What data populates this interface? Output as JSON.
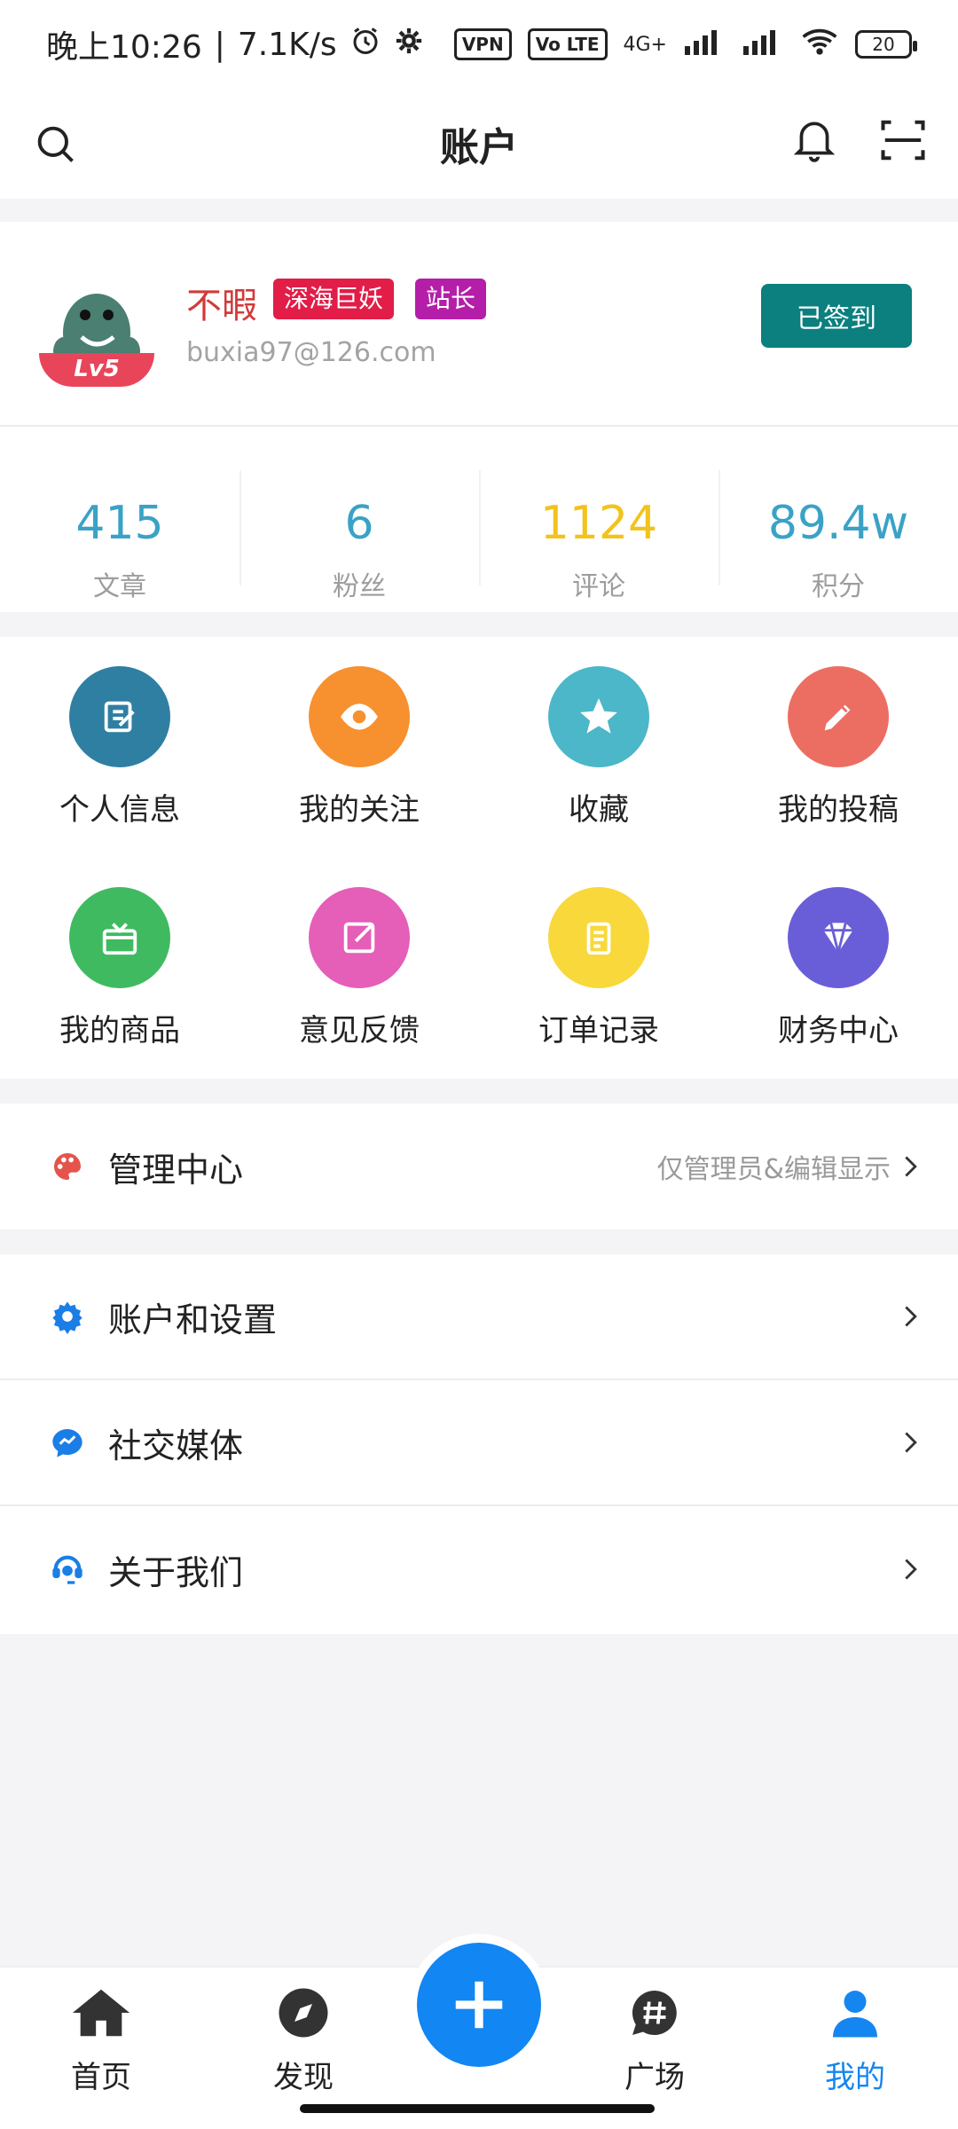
{
  "status_bar": {
    "time": "晚上10:26",
    "speed": "7.1K/s",
    "vpn": "VPN",
    "volte": "Vo LTE",
    "network": "4G+",
    "battery": "20"
  },
  "appbar": {
    "title": "账户"
  },
  "profile": {
    "name": "不暇",
    "tag_rank": "深海巨妖",
    "tag_role": "站长",
    "email": "buxia97@126.com",
    "level": "Lv5",
    "checkin_label": "已签到",
    "stats": [
      {
        "value": "415",
        "label": "文章",
        "color": "#3aa2c6"
      },
      {
        "value": "6",
        "label": "粉丝",
        "color": "#3aa2c6"
      },
      {
        "value": "1124",
        "label": "评论",
        "color": "#f2c31c"
      },
      {
        "value": "89.4w",
        "label": "积分",
        "color": "#3aa2c6"
      }
    ]
  },
  "grid": {
    "items": [
      {
        "label": "个人信息",
        "icon": "edit-icon",
        "color": "#2f7fa3"
      },
      {
        "label": "我的关注",
        "icon": "eye-icon",
        "color": "#f7902f"
      },
      {
        "label": "收藏",
        "icon": "star-icon",
        "color": "#4bb7c8"
      },
      {
        "label": "我的投稿",
        "icon": "pen-icon",
        "color": "#ec6e62"
      },
      {
        "label": "我的商品",
        "icon": "gift-icon",
        "color": "#3fba61"
      },
      {
        "label": "意见反馈",
        "icon": "feedback-icon",
        "color": "#e55eb7"
      },
      {
        "label": "订单记录",
        "icon": "clipboard-icon",
        "color": "#f8d83a"
      },
      {
        "label": "财务中心",
        "icon": "diamond-icon",
        "color": "#6a5ed8"
      }
    ]
  },
  "admin_section": {
    "label": "管理中心",
    "hint": "仅管理员&编辑显示"
  },
  "settings_section": {
    "rows": [
      {
        "label": "账户和设置",
        "icon": "gear-icon"
      },
      {
        "label": "社交媒体",
        "icon": "chat-icon"
      },
      {
        "label": "关于我们",
        "icon": "support-icon"
      }
    ]
  },
  "bottom_nav": {
    "items": [
      {
        "label": "首页",
        "icon": "home-icon"
      },
      {
        "label": "发现",
        "icon": "compass-icon"
      },
      {
        "label": "广场",
        "icon": "hash-chat-icon"
      },
      {
        "label": "我的",
        "icon": "user-icon"
      }
    ]
  }
}
